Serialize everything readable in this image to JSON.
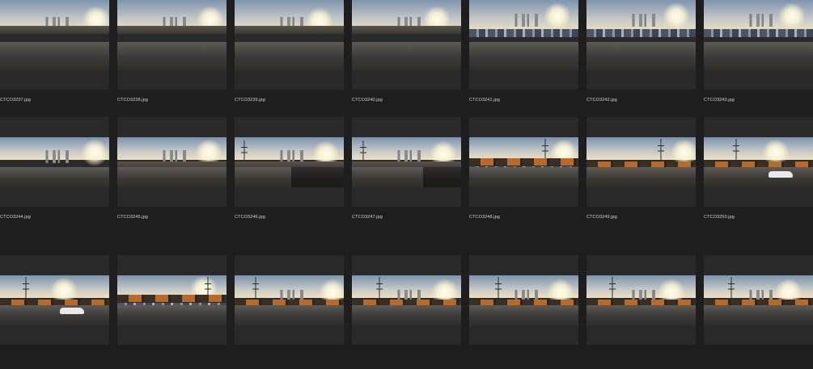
{
  "browser": {
    "rows": [
      [
        {
          "filename": "CTCO3237.jpg"
        },
        {
          "filename": "CTCO3238.jpg"
        },
        {
          "filename": "CTCO3239.jpg"
        },
        {
          "filename": "CTCO3240.jpg"
        },
        {
          "filename": "CTCO3241.jpg"
        },
        {
          "filename": "CTCO3242.jpg"
        },
        {
          "filename": "CTCO3243.jpg"
        }
      ],
      [
        {
          "filename": "CTCO3244.jpg"
        },
        {
          "filename": "CTCO3245.jpg"
        },
        {
          "filename": "CTCO3246.jpg"
        },
        {
          "filename": "CTCO3247.jpg"
        },
        {
          "filename": "CTCO3248.jpg"
        },
        {
          "filename": "CTCO3249.jpg"
        },
        {
          "filename": "CTCO3250.jpg"
        }
      ],
      [
        {
          "filename": ""
        },
        {
          "filename": ""
        },
        {
          "filename": ""
        },
        {
          "filename": ""
        },
        {
          "filename": ""
        },
        {
          "filename": ""
        },
        {
          "filename": ""
        }
      ]
    ],
    "colors": {
      "background": "#1e1e1e",
      "tile": "#2a2a2a",
      "label": "#d7d7d7"
    }
  }
}
